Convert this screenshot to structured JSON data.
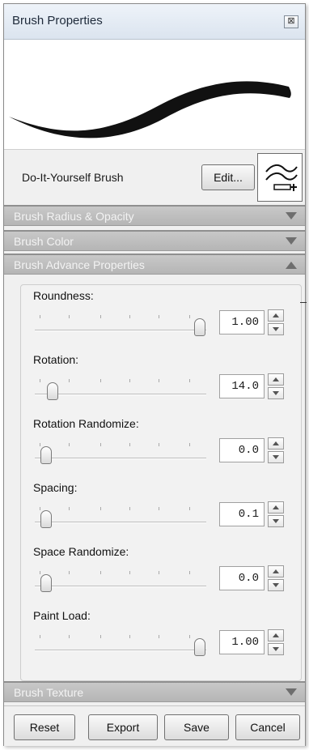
{
  "window": {
    "title": "Brush Properties",
    "close_glyph": "⊠"
  },
  "preview": {
    "icon": "brush-stroke-preview"
  },
  "brush": {
    "name": "Do-It-Yourself Brush",
    "edit_label": "Edit...",
    "thumbnail_icon": "brush-thumbnail-icon"
  },
  "sections": {
    "radius_opacity": "Brush Radius & Opacity",
    "color": "Brush Color",
    "advance": "Brush Advance Properties",
    "texture": "Brush Texture"
  },
  "properties": [
    {
      "label": "Roundness:",
      "value": "1.00",
      "level": 1.0
    },
    {
      "label": "Rotation:",
      "value": "14.0",
      "level": 0.04
    },
    {
      "label": "Rotation Randomize:",
      "value": "0.0",
      "level": 0.0
    },
    {
      "label": "Spacing:",
      "value": "0.1",
      "level": 0.0
    },
    {
      "label": "Space Randomize:",
      "value": "0.0",
      "level": 0.0
    },
    {
      "label": "Paint Load:",
      "value": "1.00",
      "level": 1.0
    }
  ],
  "footer": {
    "reset": "Reset",
    "export": "Export",
    "save": "Save",
    "cancel": "Cancel"
  },
  "colors": {
    "section_header": "#b8b8b8",
    "panel_bg": "#f0f0f0"
  }
}
